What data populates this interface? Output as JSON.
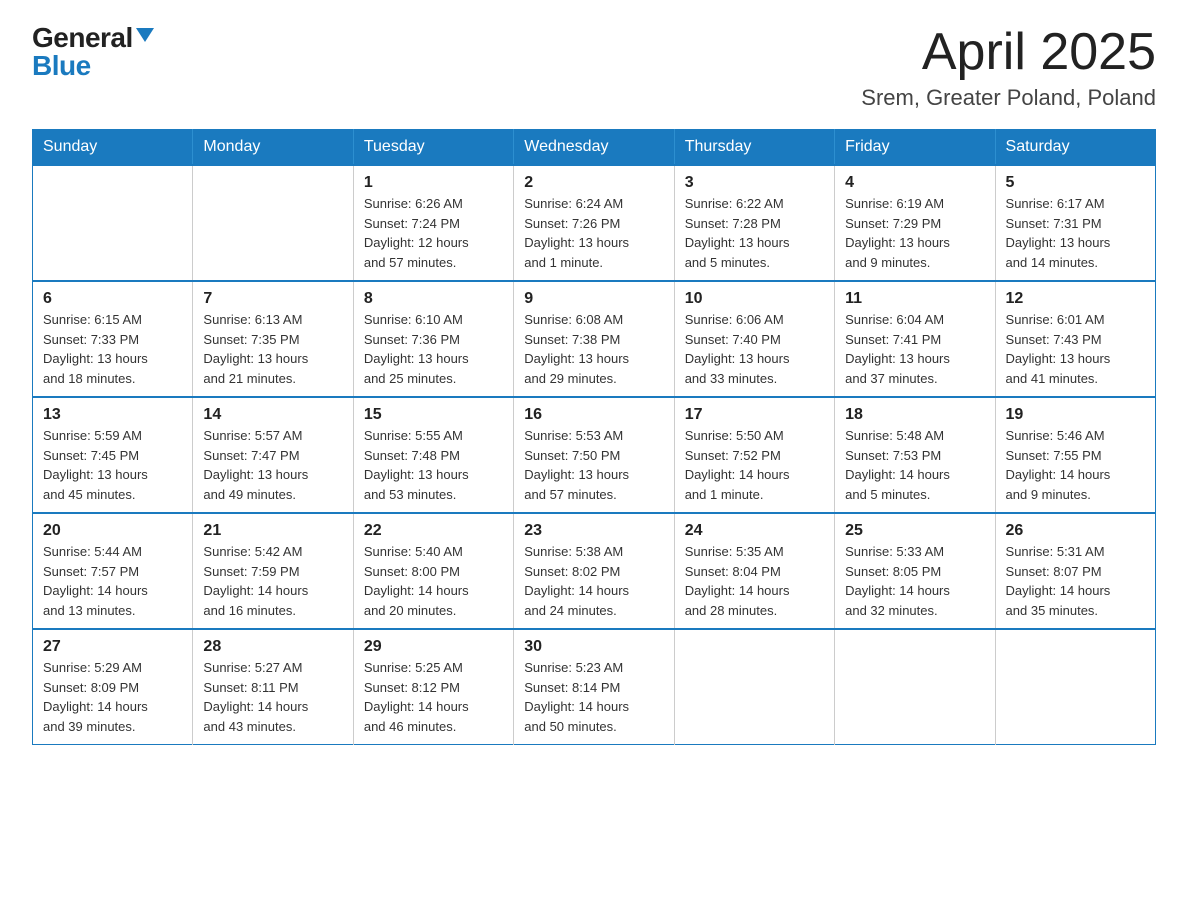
{
  "logo": {
    "general": "General",
    "blue": "Blue"
  },
  "title": "April 2025",
  "subtitle": "Srem, Greater Poland, Poland",
  "weekdays": [
    "Sunday",
    "Monday",
    "Tuesday",
    "Wednesday",
    "Thursday",
    "Friday",
    "Saturday"
  ],
  "weeks": [
    [
      {
        "day": "",
        "info": ""
      },
      {
        "day": "",
        "info": ""
      },
      {
        "day": "1",
        "info": "Sunrise: 6:26 AM\nSunset: 7:24 PM\nDaylight: 12 hours\nand 57 minutes."
      },
      {
        "day": "2",
        "info": "Sunrise: 6:24 AM\nSunset: 7:26 PM\nDaylight: 13 hours\nand 1 minute."
      },
      {
        "day": "3",
        "info": "Sunrise: 6:22 AM\nSunset: 7:28 PM\nDaylight: 13 hours\nand 5 minutes."
      },
      {
        "day": "4",
        "info": "Sunrise: 6:19 AM\nSunset: 7:29 PM\nDaylight: 13 hours\nand 9 minutes."
      },
      {
        "day": "5",
        "info": "Sunrise: 6:17 AM\nSunset: 7:31 PM\nDaylight: 13 hours\nand 14 minutes."
      }
    ],
    [
      {
        "day": "6",
        "info": "Sunrise: 6:15 AM\nSunset: 7:33 PM\nDaylight: 13 hours\nand 18 minutes."
      },
      {
        "day": "7",
        "info": "Sunrise: 6:13 AM\nSunset: 7:35 PM\nDaylight: 13 hours\nand 21 minutes."
      },
      {
        "day": "8",
        "info": "Sunrise: 6:10 AM\nSunset: 7:36 PM\nDaylight: 13 hours\nand 25 minutes."
      },
      {
        "day": "9",
        "info": "Sunrise: 6:08 AM\nSunset: 7:38 PM\nDaylight: 13 hours\nand 29 minutes."
      },
      {
        "day": "10",
        "info": "Sunrise: 6:06 AM\nSunset: 7:40 PM\nDaylight: 13 hours\nand 33 minutes."
      },
      {
        "day": "11",
        "info": "Sunrise: 6:04 AM\nSunset: 7:41 PM\nDaylight: 13 hours\nand 37 minutes."
      },
      {
        "day": "12",
        "info": "Sunrise: 6:01 AM\nSunset: 7:43 PM\nDaylight: 13 hours\nand 41 minutes."
      }
    ],
    [
      {
        "day": "13",
        "info": "Sunrise: 5:59 AM\nSunset: 7:45 PM\nDaylight: 13 hours\nand 45 minutes."
      },
      {
        "day": "14",
        "info": "Sunrise: 5:57 AM\nSunset: 7:47 PM\nDaylight: 13 hours\nand 49 minutes."
      },
      {
        "day": "15",
        "info": "Sunrise: 5:55 AM\nSunset: 7:48 PM\nDaylight: 13 hours\nand 53 minutes."
      },
      {
        "day": "16",
        "info": "Sunrise: 5:53 AM\nSunset: 7:50 PM\nDaylight: 13 hours\nand 57 minutes."
      },
      {
        "day": "17",
        "info": "Sunrise: 5:50 AM\nSunset: 7:52 PM\nDaylight: 14 hours\nand 1 minute."
      },
      {
        "day": "18",
        "info": "Sunrise: 5:48 AM\nSunset: 7:53 PM\nDaylight: 14 hours\nand 5 minutes."
      },
      {
        "day": "19",
        "info": "Sunrise: 5:46 AM\nSunset: 7:55 PM\nDaylight: 14 hours\nand 9 minutes."
      }
    ],
    [
      {
        "day": "20",
        "info": "Sunrise: 5:44 AM\nSunset: 7:57 PM\nDaylight: 14 hours\nand 13 minutes."
      },
      {
        "day": "21",
        "info": "Sunrise: 5:42 AM\nSunset: 7:59 PM\nDaylight: 14 hours\nand 16 minutes."
      },
      {
        "day": "22",
        "info": "Sunrise: 5:40 AM\nSunset: 8:00 PM\nDaylight: 14 hours\nand 20 minutes."
      },
      {
        "day": "23",
        "info": "Sunrise: 5:38 AM\nSunset: 8:02 PM\nDaylight: 14 hours\nand 24 minutes."
      },
      {
        "day": "24",
        "info": "Sunrise: 5:35 AM\nSunset: 8:04 PM\nDaylight: 14 hours\nand 28 minutes."
      },
      {
        "day": "25",
        "info": "Sunrise: 5:33 AM\nSunset: 8:05 PM\nDaylight: 14 hours\nand 32 minutes."
      },
      {
        "day": "26",
        "info": "Sunrise: 5:31 AM\nSunset: 8:07 PM\nDaylight: 14 hours\nand 35 minutes."
      }
    ],
    [
      {
        "day": "27",
        "info": "Sunrise: 5:29 AM\nSunset: 8:09 PM\nDaylight: 14 hours\nand 39 minutes."
      },
      {
        "day": "28",
        "info": "Sunrise: 5:27 AM\nSunset: 8:11 PM\nDaylight: 14 hours\nand 43 minutes."
      },
      {
        "day": "29",
        "info": "Sunrise: 5:25 AM\nSunset: 8:12 PM\nDaylight: 14 hours\nand 46 minutes."
      },
      {
        "day": "30",
        "info": "Sunrise: 5:23 AM\nSunset: 8:14 PM\nDaylight: 14 hours\nand 50 minutes."
      },
      {
        "day": "",
        "info": ""
      },
      {
        "day": "",
        "info": ""
      },
      {
        "day": "",
        "info": ""
      }
    ]
  ]
}
